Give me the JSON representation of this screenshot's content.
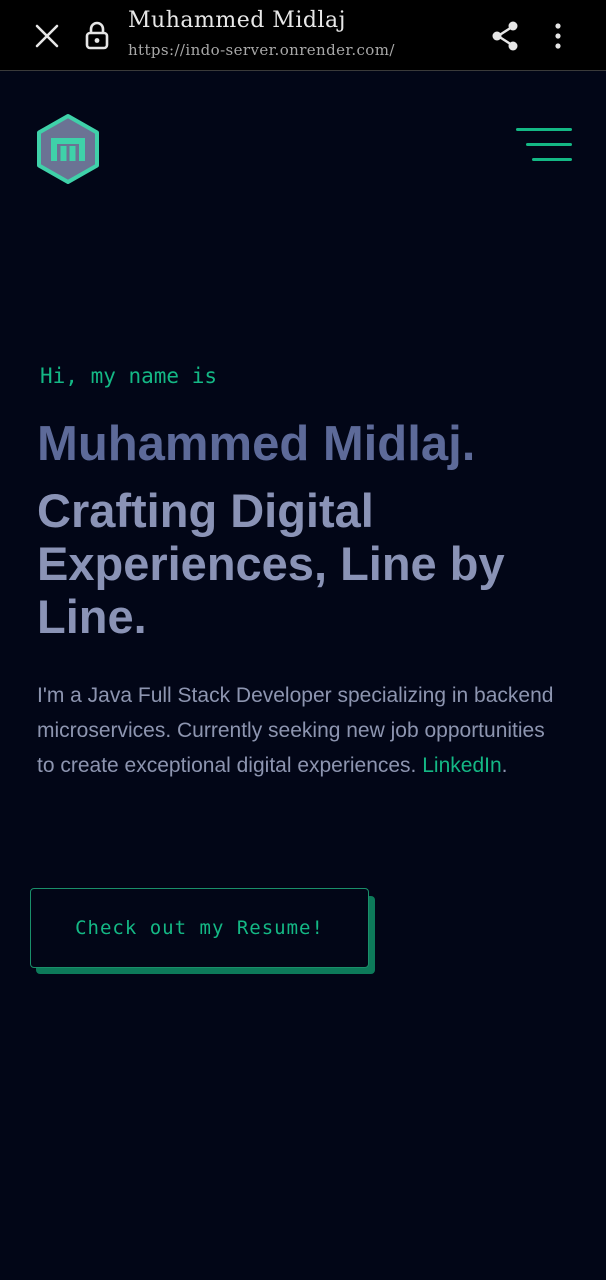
{
  "browser": {
    "title": "Muhammed Midlaj",
    "url": "https://indo-server.onrender.com/",
    "icons": [
      "close-icon",
      "lock-icon",
      "share-icon",
      "more-vert-icon"
    ]
  },
  "header": {
    "logo_letter": "m",
    "logo_icon": "hexagon-logo",
    "menu_icon": "hamburger-menu-icon"
  },
  "hero": {
    "greeting": "Hi, my name is",
    "name": "Muhammed Midlaj.",
    "tagline": "Crafting Digital Experiences, Line by Line.",
    "bio_text": "I'm a Java Full Stack Developer specializing in backend microservices. Currently seeking new job opportunities to create exceptional digital experiences. ",
    "bio_link": "LinkedIn",
    "bio_end": ".",
    "cta_label": "Check out my Resume!"
  },
  "colors": {
    "background": "#020617",
    "accent": "#14b885",
    "name": "#5d6a99",
    "tagline": "#8a93b6",
    "body_text": "#8d95b0"
  }
}
